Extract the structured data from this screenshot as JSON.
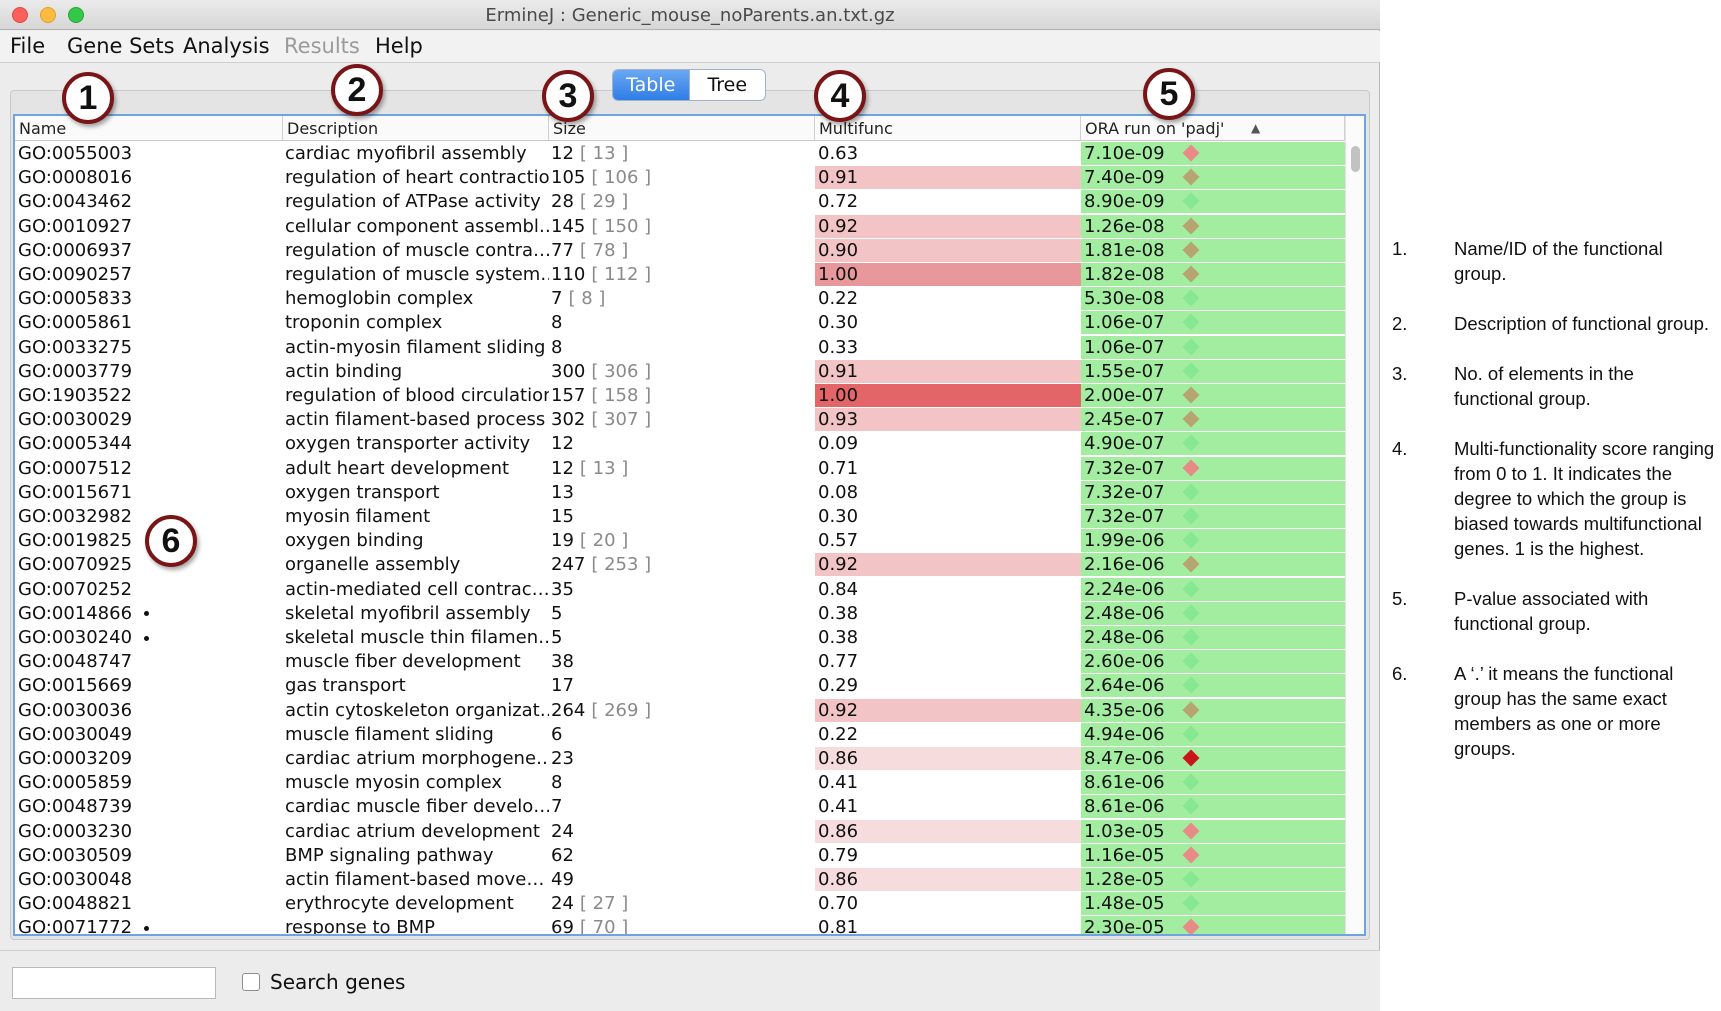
{
  "window": {
    "title": "ErmineJ : Generic_mouse_noParents.an.txt.gz"
  },
  "menu": [
    "File",
    "Gene Sets",
    "Analysis",
    "Results",
    "Help"
  ],
  "view_toggle": {
    "table": "Table",
    "tree": "Tree"
  },
  "table": {
    "headers": {
      "name": "Name",
      "description": "Description",
      "size": "Size",
      "multifunc": "Multifunc",
      "ora": "ORA run on 'padj'"
    },
    "sort_indicator": "▲",
    "rows": [
      {
        "name": "GO:0055003",
        "dot": false,
        "desc": "cardiac myofibril assembly",
        "size": "12",
        "size_full": "[ 13 ]",
        "multi": "0.63",
        "pval": "7.10e-09",
        "diamond": "#e88a86"
      },
      {
        "name": "GO:0008016",
        "dot": false,
        "desc": "regulation of heart contraction",
        "size": "105",
        "size_full": "[ 106 ]",
        "multi": "0.91",
        "pval": "7.40e-09",
        "diamond": "#b7a571"
      },
      {
        "name": "GO:0043462",
        "dot": false,
        "desc": "regulation of ATPase activity",
        "size": "28",
        "size_full": "[ 29 ]",
        "multi": "0.72",
        "pval": "8.90e-09",
        "diamond": "#86e891"
      },
      {
        "name": "GO:0010927",
        "dot": false,
        "desc": "cellular component assembl…",
        "size": "145",
        "size_full": "[ 150 ]",
        "multi": "0.92",
        "pval": "1.26e-08",
        "diamond": "#b7a571"
      },
      {
        "name": "GO:0006937",
        "dot": false,
        "desc": "regulation of muscle contra…",
        "size": "77",
        "size_full": "[ 78 ]",
        "multi": "0.90",
        "pval": "1.81e-08",
        "diamond": "#b7a571"
      },
      {
        "name": "GO:0090257",
        "dot": false,
        "desc": "regulation of muscle system…",
        "size": "110",
        "size_full": "[ 112 ]",
        "multi": "1.00",
        "pval": "1.82e-08",
        "diamond": "#b7a571"
      },
      {
        "name": "GO:0005833",
        "dot": false,
        "desc": "hemoglobin complex",
        "size": "7",
        "size_full": "[ 8 ]",
        "multi": "0.22",
        "pval": "5.30e-08",
        "diamond": "#86e891"
      },
      {
        "name": "GO:0005861",
        "dot": false,
        "desc": "troponin complex",
        "size": "8",
        "size_full": "",
        "multi": "0.30",
        "pval": "1.06e-07",
        "diamond": "#86e891"
      },
      {
        "name": "GO:0033275",
        "dot": false,
        "desc": "actin-myosin filament sliding",
        "size": "8",
        "size_full": "",
        "multi": "0.33",
        "pval": "1.06e-07",
        "diamond": "#86e891"
      },
      {
        "name": "GO:0003779",
        "dot": false,
        "desc": "actin binding",
        "size": "300",
        "size_full": "[ 306 ]",
        "multi": "0.91",
        "pval": "1.55e-07",
        "diamond": "#86e891"
      },
      {
        "name": "GO:1903522",
        "dot": false,
        "desc": "regulation of blood circulation",
        "size": "157",
        "size_full": "[ 158 ]",
        "multi": "1.00",
        "pval": "2.00e-07",
        "diamond": "#b7a571"
      },
      {
        "name": "GO:0030029",
        "dot": false,
        "desc": "actin filament-based process",
        "size": "302",
        "size_full": "[ 307 ]",
        "multi": "0.93",
        "pval": "2.45e-07",
        "diamond": "#b7a571"
      },
      {
        "name": "GO:0005344",
        "dot": false,
        "desc": "oxygen transporter activity",
        "size": "12",
        "size_full": "",
        "multi": "0.09",
        "pval": "4.90e-07",
        "diamond": "#86e891"
      },
      {
        "name": "GO:0007512",
        "dot": false,
        "desc": "adult heart development",
        "size": "12",
        "size_full": "[ 13 ]",
        "multi": "0.71",
        "pval": "7.32e-07",
        "diamond": "#e88a86"
      },
      {
        "name": "GO:0015671",
        "dot": false,
        "desc": "oxygen transport",
        "size": "13",
        "size_full": "",
        "multi": "0.08",
        "pval": "7.32e-07",
        "diamond": "#86e891"
      },
      {
        "name": "GO:0032982",
        "dot": false,
        "desc": "myosin filament",
        "size": "15",
        "size_full": "",
        "multi": "0.30",
        "pval": "7.32e-07",
        "diamond": "#86e891"
      },
      {
        "name": "GO:0019825",
        "dot": false,
        "desc": "oxygen binding",
        "size": "19",
        "size_full": "[ 20 ]",
        "multi": "0.57",
        "pval": "1.99e-06",
        "diamond": "#86e891"
      },
      {
        "name": "GO:0070925",
        "dot": false,
        "desc": "organelle assembly",
        "size": "247",
        "size_full": "[ 253 ]",
        "multi": "0.92",
        "pval": "2.16e-06",
        "diamond": "#b7a571"
      },
      {
        "name": "GO:0070252",
        "dot": false,
        "desc": "actin-mediated cell contrac…",
        "size": "35",
        "size_full": "",
        "multi": "0.84",
        "pval": "2.24e-06",
        "diamond": "#86e891"
      },
      {
        "name": "GO:0014866",
        "dot": true,
        "desc": "skeletal myofibril assembly",
        "size": "5",
        "size_full": "",
        "multi": "0.38",
        "pval": "2.48e-06",
        "diamond": "#86e891"
      },
      {
        "name": "GO:0030240",
        "dot": true,
        "desc": "skeletal muscle thin filamen…",
        "size": "5",
        "size_full": "",
        "multi": "0.38",
        "pval": "2.48e-06",
        "diamond": "#86e891"
      },
      {
        "name": "GO:0048747",
        "dot": false,
        "desc": "muscle fiber development",
        "size": "38",
        "size_full": "",
        "multi": "0.77",
        "pval": "2.60e-06",
        "diamond": "#86e891"
      },
      {
        "name": "GO:0015669",
        "dot": false,
        "desc": "gas transport",
        "size": "17",
        "size_full": "",
        "multi": "0.29",
        "pval": "2.64e-06",
        "diamond": "#86e891"
      },
      {
        "name": "GO:0030036",
        "dot": false,
        "desc": "actin cytoskeleton organizat…",
        "size": "264",
        "size_full": "[ 269 ]",
        "multi": "0.92",
        "pval": "4.35e-06",
        "diamond": "#b7a571"
      },
      {
        "name": "GO:0030049",
        "dot": false,
        "desc": "muscle filament sliding",
        "size": "6",
        "size_full": "",
        "multi": "0.22",
        "pval": "4.94e-06",
        "diamond": "#86e891"
      },
      {
        "name": "GO:0003209",
        "dot": false,
        "desc": "cardiac atrium morphogene…",
        "size": "23",
        "size_full": "",
        "multi": "0.86",
        "pval": "8.47e-06",
        "diamond": "#c8161b"
      },
      {
        "name": "GO:0005859",
        "dot": false,
        "desc": "muscle myosin complex",
        "size": "8",
        "size_full": "",
        "multi": "0.41",
        "pval": "8.61e-06",
        "diamond": "#86e891"
      },
      {
        "name": "GO:0048739",
        "dot": false,
        "desc": "cardiac muscle fiber develo…",
        "size": "7",
        "size_full": "",
        "multi": "0.41",
        "pval": "8.61e-06",
        "diamond": "#86e891"
      },
      {
        "name": "GO:0003230",
        "dot": false,
        "desc": "cardiac atrium development",
        "size": "24",
        "size_full": "",
        "multi": "0.86",
        "pval": "1.03e-05",
        "diamond": "#e88a86"
      },
      {
        "name": "GO:0030509",
        "dot": false,
        "desc": "BMP signaling pathway",
        "size": "62",
        "size_full": "",
        "multi": "0.79",
        "pval": "1.16e-05",
        "diamond": "#e88a86"
      },
      {
        "name": "GO:0030048",
        "dot": false,
        "desc": "actin filament-based move…",
        "size": "49",
        "size_full": "",
        "multi": "0.86",
        "pval": "1.28e-05",
        "diamond": "#86e891"
      },
      {
        "name": "GO:0048821",
        "dot": false,
        "desc": "erythrocyte development",
        "size": "24",
        "size_full": "[ 27 ]",
        "multi": "0.70",
        "pval": "1.48e-05",
        "diamond": "#86e891"
      },
      {
        "name": "GO:0071772",
        "dot": true,
        "desc": "response to BMP",
        "size": "69",
        "size_full": "[ 70 ]",
        "multi": "0.81",
        "pval": "2.30e-05",
        "diamond": "#e88a86"
      }
    ]
  },
  "bottom": {
    "search_value": "",
    "search_genes_label": "Search genes"
  },
  "callouts": [
    "1",
    "2",
    "3",
    "4",
    "5",
    "6"
  ],
  "legend": [
    {
      "num": "1.",
      "text": "Name/ID of the functional group."
    },
    {
      "num": "2.",
      "text": "Description of functional group."
    },
    {
      "num": "3.",
      "text": "No. of elements in the functional group."
    },
    {
      "num": "4.",
      "text": "Multi-functionality score ranging  from 0 to 1. It indicates the degree to which the group is biased towards multifunctional genes. 1 is the highest."
    },
    {
      "num": "5.",
      "text": "P-value associated with functional group."
    },
    {
      "num": "6.",
      "text": "A ‘.’ it means the functional group has the same exact members as one or more groups."
    }
  ],
  "colors": {
    "ora_fill": "#a3eda0",
    "multi_low": "#f6dcdd",
    "multi_mid": "#f2c4c5",
    "multi_high": "#e8979a",
    "multi_max": "#e46567",
    "accent": "#2f7de6"
  }
}
